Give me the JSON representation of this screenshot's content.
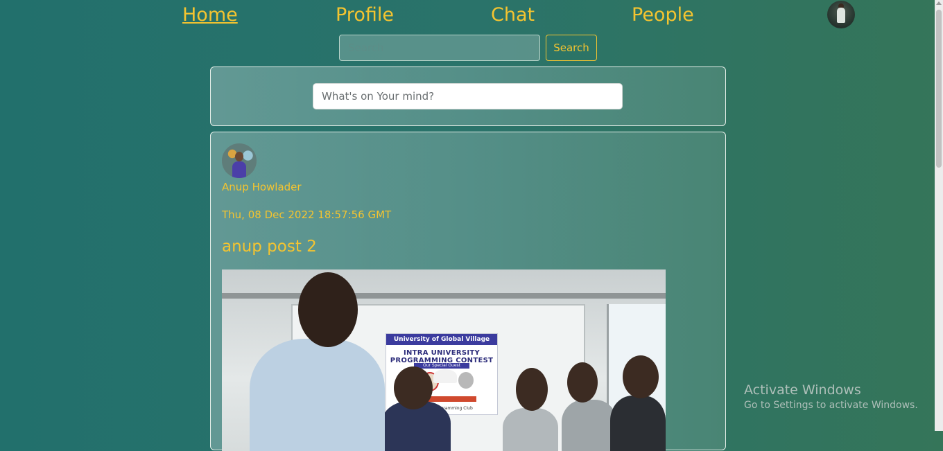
{
  "nav": {
    "items": [
      {
        "label": "Home",
        "active": true
      },
      {
        "label": "Profile",
        "active": false
      },
      {
        "label": "Chat",
        "active": false
      },
      {
        "label": "People",
        "active": false
      }
    ]
  },
  "search": {
    "placeholder": "Search",
    "value": "",
    "button_label": "Search"
  },
  "composer": {
    "placeholder": "What's on Your mind?"
  },
  "post": {
    "author": "Anup Howlader",
    "date": "Thu, 08 Dec 2022 18:57:56 GMT",
    "title": "anup post 2",
    "photo": {
      "banner_header": "University of Global Village",
      "banner_title": "INTRA UNIVERSITY PROGRAMMING CONTEST",
      "banner_subtitle": "Our Special Guest",
      "banner_footer": "ed by UGV Programming Club"
    }
  },
  "watermark": {
    "title": "Activate Windows",
    "subtitle": "Go to Settings to activate Windows."
  },
  "colors": {
    "accent": "#f4c430",
    "background_start": "#22706c",
    "background_end": "#357559"
  }
}
